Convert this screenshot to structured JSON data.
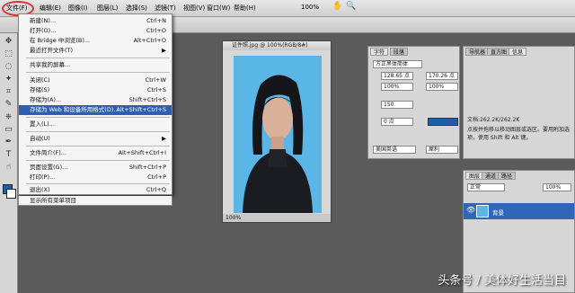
{
  "menubar": {
    "items": [
      "文件(F)",
      "编辑(E)",
      "图像(I)",
      "图层(L)",
      "选择(S)",
      "滤镜(T)",
      "视图(V)",
      "窗口(W)",
      "帮助(H)"
    ]
  },
  "optbar": {
    "zoom": "100%"
  },
  "file_menu": {
    "items": [
      {
        "label": "新建(N)...",
        "shortcut": "Ctrl+N"
      },
      {
        "label": "打开(O)...",
        "shortcut": "Ctrl+O"
      },
      {
        "label": "在 Bridge 中浏览(B)...",
        "shortcut": "Alt+Ctrl+O"
      },
      {
        "label": "最近打开文件(T)",
        "shortcut": "▶"
      },
      {
        "label": "共享我的屏幕...",
        "shortcut": ""
      },
      {
        "label": "关闭(C)",
        "shortcut": "Ctrl+W"
      },
      {
        "label": "存储(S)",
        "shortcut": "Ctrl+S"
      },
      {
        "label": "存储为(A)...",
        "shortcut": "Shift+Ctrl+S"
      },
      {
        "label": "存储为 Web 和设备所用格式(D)...",
        "shortcut": "Alt+Shift+Ctrl+S"
      },
      {
        "label": "置入(L)...",
        "shortcut": ""
      },
      {
        "label": "自动(U)",
        "shortcut": "▶"
      },
      {
        "label": "文件简介(F)...",
        "shortcut": "Alt+Shift+Ctrl+I"
      },
      {
        "label": "页面设置(G)...",
        "shortcut": "Shift+Ctrl+P"
      },
      {
        "label": "打印(P)...",
        "shortcut": "Ctrl+P"
      },
      {
        "label": "退出(X)",
        "shortcut": "Ctrl+Q"
      },
      {
        "label": "显示所有菜单项目",
        "shortcut": ""
      }
    ]
  },
  "document": {
    "title": "证件照.jpg @ 100%(RGB/8#)",
    "status_zoom": "100%"
  },
  "char_panel": {
    "tabs": [
      "字符",
      "段落"
    ],
    "font": "方正黑体简体",
    "size": "128.65 点",
    "leading": "170.26 点",
    "scale_v": "100%",
    "scale_h": "100%",
    "tracking": "150",
    "kerning": "0 点",
    "lang": "美国英语",
    "aa": "犀利"
  },
  "info_panel": {
    "tabs": [
      "导航器",
      "直方图",
      "信息"
    ],
    "doc_info": "文档:262.2K/262.2K",
    "hint": "点按并拖移以移动图层或选区。要用附加选项，使用 Shift 和 Alt 键。"
  },
  "layers_panel": {
    "tabs": [
      "图层",
      "通道",
      "路径"
    ],
    "mode": "正常",
    "opacity": "100%",
    "layer_name": "背景"
  },
  "watermark": "头条号 / 美体好生活当目"
}
